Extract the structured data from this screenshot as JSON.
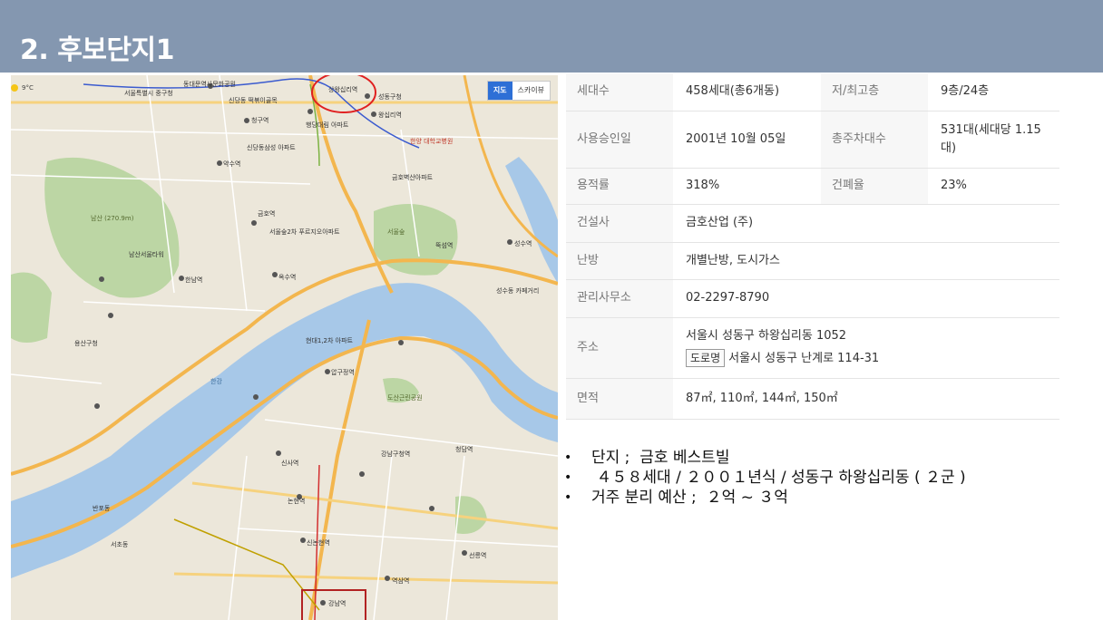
{
  "slide": {
    "title": "2. 후보단지1"
  },
  "map": {
    "controls": {
      "map_label": "지도",
      "sky_label": "스카이뷰"
    },
    "weather": "9°C",
    "labels": {
      "dongdaemun": "동대문역사문화공원",
      "seoul_station": "서울특별시 중구청",
      "sindang": "신당동 떡볶이골목",
      "sangwangsimni": "상왕십리역",
      "seongdong": "성동구청",
      "wangsimni": "왕십리역",
      "haengdang": "행당대림 아파트",
      "hanyang": "한양 대학교병원",
      "cheonggu": "청구역",
      "sindang_apt": "신당동삼성 아파트",
      "yaksu": "약수역",
      "geumho": "금호역",
      "geumho_apt": "서울숲2차 푸르지오아파트",
      "oksu": "옥수역",
      "namsan": "남산 (270.9m)",
      "namsan_tower": "남산서울타워",
      "hannam": "한남역",
      "yongsan": "용산구청",
      "apgujeong": "압구정역",
      "hyundai": "현대1,2차 아파트",
      "sinsa": "신사역",
      "gangnam_gu": "강남구청역",
      "cheongdam": "청담역",
      "nonhyeon": "논현역",
      "sinnonhyeon": "신논현역",
      "gangnam": "강남역",
      "yeoksam": "역삼역",
      "seolleung": "선릉역",
      "seoul_forest": "서울숲",
      "ttukseom": "뚝섬역",
      "seongsu": "성수역",
      "seocho": "서초동",
      "banpo": "반포동",
      "river": "한강",
      "dosan": "도산근린공원",
      "seongsu_dong": "성수동 카페거리",
      "goldfield": "금호벽산아파트"
    }
  },
  "info": {
    "row1": {
      "k1": "세대수",
      "v1": "458세대(총6개동)",
      "k2": "저/최고층",
      "v2": "9층/24층"
    },
    "row2": {
      "k1": "사용승인일",
      "v1": "2001년 10월 05일",
      "k2": "총주차대수",
      "v2_line1": "531대(세대당 1.15",
      "v2_line2": "대)"
    },
    "row3": {
      "k1": "용적률",
      "v1": "318%",
      "k2": "건폐율",
      "v2": "23%"
    },
    "row4": {
      "k": "건설사",
      "v": "금호산업 (주)"
    },
    "row5": {
      "k": "난방",
      "v": "개별난방, 도시가스"
    },
    "row6": {
      "k": "관리사무소",
      "v": "02-2297-8790"
    },
    "row7": {
      "k": "주소",
      "v_line1": "서울시 성동구 하왕십리동 1052",
      "badge": "도로명",
      "v_line2": "서울시 성동구 난계로 114-31"
    },
    "row8": {
      "k": "면적",
      "v": "87㎡, 110㎡, 144㎡, 150㎡"
    }
  },
  "bullets": [
    "단지 ;  금호 베스트빌",
    " ４５８세대 / ２００１년식 / 성동구 하왕십리동 ( ２군 )",
    "거주 분리 예산 ;  ２억 ~ ３억"
  ],
  "colors": {
    "header": "#8497b0",
    "river": "#a7c8e8",
    "park": "#bcd6a4",
    "highlight": "#e02020",
    "marker": "#b22222"
  }
}
